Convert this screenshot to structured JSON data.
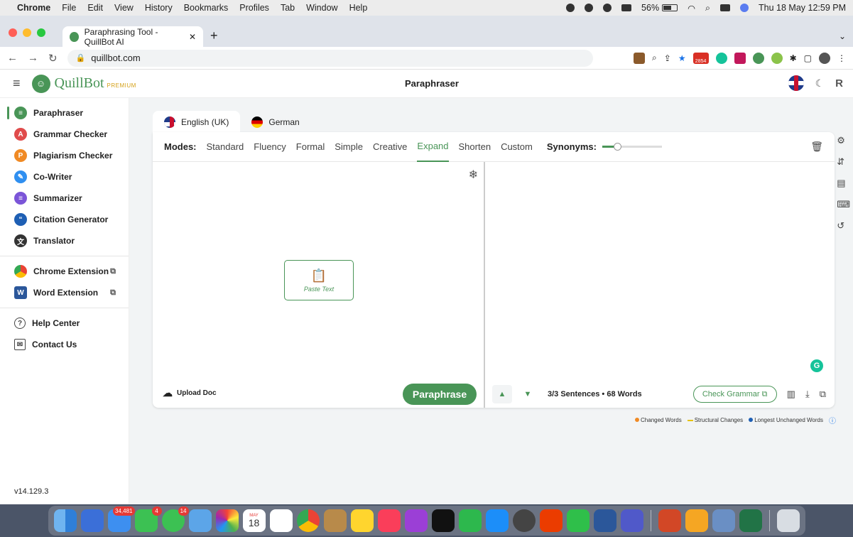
{
  "menubar": {
    "app_name": "Chrome",
    "items": [
      "File",
      "Edit",
      "View",
      "History",
      "Bookmarks",
      "Profiles",
      "Tab",
      "Window",
      "Help"
    ],
    "battery": "56%",
    "datetime": "Thu 18 May  12:59 PM"
  },
  "browser": {
    "tab_title": "Paraphrasing Tool - QuillBot AI",
    "url": "quillbot.com",
    "ext_badge": "2854"
  },
  "app": {
    "logo_text": "QuillBot",
    "logo_badge": "PREMIUM",
    "page_title": "Paraphraser",
    "avatar_initial": "R"
  },
  "sidebar": {
    "items": [
      {
        "label": "Paraphraser",
        "color": "#499557"
      },
      {
        "label": "Grammar Checker",
        "color": "#e04b4b"
      },
      {
        "label": "Plagiarism Checker",
        "color": "#f08a24"
      },
      {
        "label": "Co-Writer",
        "color": "#2f8ff0"
      },
      {
        "label": "Summarizer",
        "color": "#7b55d8"
      },
      {
        "label": "Citation Generator",
        "color": "#1e5fb4"
      },
      {
        "label": "Translator",
        "color": "#333333"
      }
    ],
    "extensions": [
      {
        "label": "Chrome Extension"
      },
      {
        "label": "Word Extension"
      }
    ],
    "help": [
      {
        "label": "Help Center"
      },
      {
        "label": "Contact Us"
      }
    ],
    "version": "v14.129.3"
  },
  "editor": {
    "languages": [
      "English (UK)",
      "German"
    ],
    "modes_label": "Modes:",
    "modes": [
      "Standard",
      "Fluency",
      "Formal",
      "Simple",
      "Creative",
      "Expand",
      "Shorten",
      "Custom"
    ],
    "active_mode": "Expand",
    "synonyms_label": "Synonyms:",
    "synonyms_level": 0.25,
    "paste_label": "Paste Text",
    "upload_label": "Upload Doc",
    "paraphrase_label": "Paraphrase",
    "sentence_count": "3/3 Sentences • 68 Words",
    "check_grammar_label": "Check Grammar"
  },
  "legend": {
    "changed": {
      "label": "Changed Words",
      "color": "#f08a24"
    },
    "structural": {
      "label": "Structural Changes",
      "color": "#e6c200"
    },
    "longest": {
      "label": "Longest Unchanged Words",
      "color": "#1e5fb4"
    }
  },
  "dock": {
    "badges": {
      "mail": "34,481",
      "facetime": "4",
      "messages": "14"
    },
    "calendar_month": "MAY",
    "calendar_day": "18"
  }
}
